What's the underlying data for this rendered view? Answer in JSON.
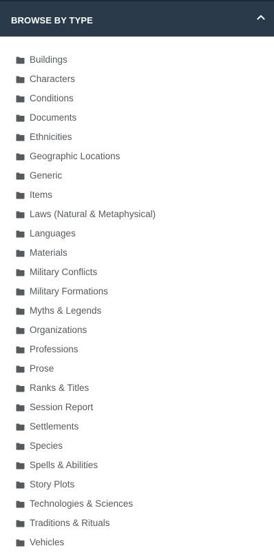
{
  "panel": {
    "title": "BROWSE BY TYPE",
    "toggle_icon": "chevron-up-icon",
    "header_color": "#2a3a4a",
    "text_color": "#555a5e"
  },
  "types": [
    {
      "label": "Buildings",
      "icon": "folder-icon"
    },
    {
      "label": "Characters",
      "icon": "folder-icon"
    },
    {
      "label": "Conditions",
      "icon": "folder-icon"
    },
    {
      "label": "Documents",
      "icon": "folder-icon"
    },
    {
      "label": "Ethnicities",
      "icon": "folder-icon"
    },
    {
      "label": "Geographic Locations",
      "icon": "folder-icon"
    },
    {
      "label": "Generic",
      "icon": "folder-icon"
    },
    {
      "label": "Items",
      "icon": "folder-icon"
    },
    {
      "label": "Laws (Natural & Metaphysical)",
      "icon": "folder-icon"
    },
    {
      "label": "Languages",
      "icon": "folder-icon"
    },
    {
      "label": "Materials",
      "icon": "folder-icon"
    },
    {
      "label": "Military Conflicts",
      "icon": "folder-icon"
    },
    {
      "label": "Military Formations",
      "icon": "folder-icon"
    },
    {
      "label": "Myths & Legends",
      "icon": "folder-icon"
    },
    {
      "label": "Organizations",
      "icon": "folder-icon"
    },
    {
      "label": "Professions",
      "icon": "folder-icon"
    },
    {
      "label": "Prose",
      "icon": "folder-icon"
    },
    {
      "label": "Ranks & Titles",
      "icon": "folder-icon"
    },
    {
      "label": "Session Report",
      "icon": "folder-icon"
    },
    {
      "label": "Settlements",
      "icon": "folder-icon"
    },
    {
      "label": "Species",
      "icon": "folder-icon"
    },
    {
      "label": "Spells & Abilities",
      "icon": "folder-icon"
    },
    {
      "label": "Story Plots",
      "icon": "folder-icon"
    },
    {
      "label": "Technologies & Sciences",
      "icon": "folder-icon"
    },
    {
      "label": "Traditions & Rituals",
      "icon": "folder-icon"
    },
    {
      "label": "Vehicles",
      "icon": "folder-icon"
    }
  ]
}
